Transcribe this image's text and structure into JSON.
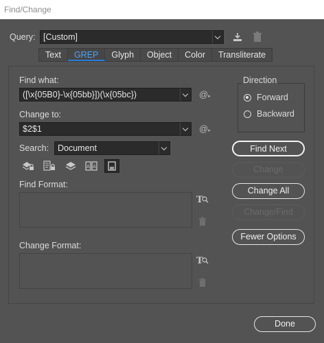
{
  "window": {
    "title": "Find/Change"
  },
  "query": {
    "label": "Query:",
    "value": "[Custom]"
  },
  "tabs": [
    {
      "label": "Text"
    },
    {
      "label": "GREP",
      "active": true
    },
    {
      "label": "Glyph"
    },
    {
      "label": "Object"
    },
    {
      "label": "Color"
    },
    {
      "label": "Transliterate"
    }
  ],
  "find_what": {
    "label": "Find what:",
    "value": "([\\x{05B0}-\\x{05bb}])(\\x{05bc})"
  },
  "change_to": {
    "label": "Change to:",
    "value": "$2$1"
  },
  "search": {
    "label": "Search:",
    "value": "Document"
  },
  "find_format": {
    "label": "Find Format:"
  },
  "change_format": {
    "label": "Change Format:"
  },
  "direction": {
    "label": "Direction",
    "forward": "Forward",
    "backward": "Backward",
    "selected": "Forward"
  },
  "buttons": {
    "find_next": "Find Next",
    "change": "Change",
    "change_all": "Change All",
    "change_find": "Change/Find",
    "fewer_options": "Fewer Options",
    "done": "Done"
  },
  "colors": {
    "background": "#535353",
    "field": "#2b2b2b",
    "active_tab_text": "#4aa3ff"
  }
}
